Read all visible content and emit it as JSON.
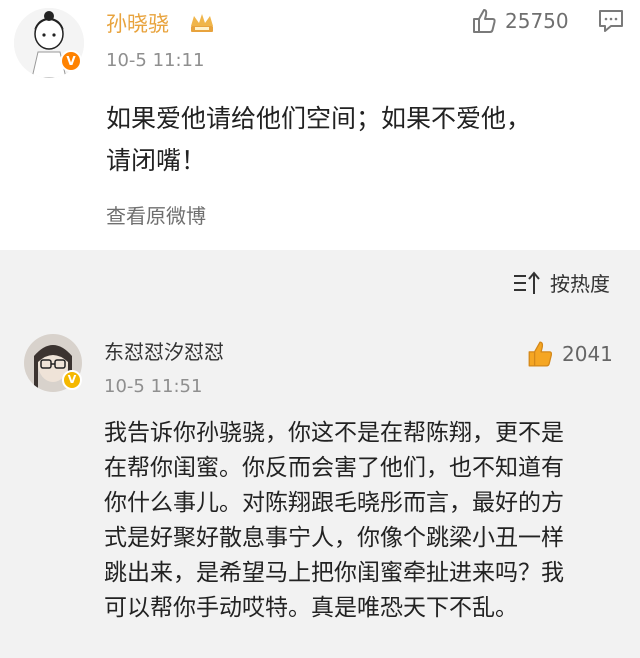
{
  "post": {
    "author": "孙晓骁",
    "time": "10-5 11:11",
    "likes": "25750",
    "text": "如果爱他请给他们空间；如果不爱他，\n请闭嘴！",
    "view_original": "查看原微博",
    "icons": [
      "avatar",
      "crown-icon",
      "verified-badge",
      "thumbs-up-icon",
      "comment-icon"
    ]
  },
  "comments": {
    "sort_label": "按热度",
    "items": [
      {
        "author": "东怼怼汐怼怼",
        "time": "10-5 11:51",
        "likes": "2041",
        "text": "我告诉你孙骁骁，你这不是在帮陈翔，更不是\n在帮你闺蜜。你反而会害了他们，也不知道有\n你什么事儿。对陈翔跟毛晓彤而言，最好的方\n式是好聚好散息事宁人，你像个跳梁小丑一样\n跳出来，是希望马上把你闺蜜牵扯进来吗？我\n可以帮你手动哎特。真是唯恐天下不乱。"
      }
    ]
  },
  "colors": {
    "author_gold": "#e8a33d",
    "background_gray": "#f2f2f2",
    "badge_orange": "#ff8200",
    "like_orange": "#f5a623"
  }
}
